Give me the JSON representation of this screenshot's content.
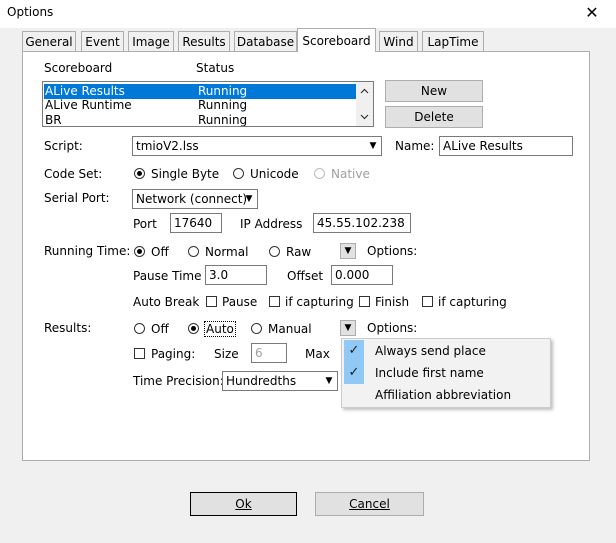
{
  "window": {
    "title": "Options",
    "close_glyph": "✕"
  },
  "tabs": [
    {
      "label": "General"
    },
    {
      "label": "Event"
    },
    {
      "label": "Image"
    },
    {
      "label": "Results"
    },
    {
      "label": "Database"
    },
    {
      "label": "Scoreboard"
    },
    {
      "label": "Wind"
    },
    {
      "label": "LapTime"
    }
  ],
  "active_tab": "Scoreboard",
  "scoreboard_list": {
    "col_scoreboard": "Scoreboard",
    "col_status": "Status",
    "rows": [
      {
        "name": "ALive Results",
        "status": "Running"
      },
      {
        "name": "ALive Runtime",
        "status": "Running"
      },
      {
        "name": "BR",
        "status": "Running"
      }
    ]
  },
  "buttons": {
    "new": "New",
    "delete": "Delete",
    "ok": "Ok",
    "cancel": "Cancel"
  },
  "script": {
    "label": "Script:",
    "value": "tmioV2.lss"
  },
  "name": {
    "label": "Name:",
    "value": "ALive Results"
  },
  "code_set": {
    "label": "Code Set:",
    "options": [
      "Single Byte",
      "Unicode",
      "Native"
    ],
    "selected": "Single Byte"
  },
  "serial_port": {
    "label": "Serial Port:",
    "value": "Network (connect)"
  },
  "port": {
    "label": "Port",
    "value": "17640"
  },
  "ip": {
    "label": "IP Address",
    "value": "45.55.102.238"
  },
  "running_time": {
    "label": "Running Time:",
    "options": [
      "Off",
      "Normal",
      "Raw"
    ],
    "selected": "Off",
    "options_label": "Options:"
  },
  "pause_time": {
    "label": "Pause Time",
    "value": "3.0"
  },
  "offset": {
    "label": "Offset",
    "value": "0.000"
  },
  "auto_break": {
    "label": "Auto Break",
    "items": [
      "Pause",
      "if capturing",
      "Finish",
      "if capturing"
    ]
  },
  "results": {
    "label": "Results:",
    "options": [
      "Off",
      "Auto",
      "Manual"
    ],
    "selected": "Auto",
    "options_label": "Options:"
  },
  "paging": {
    "label": "Paging:",
    "size_label": "Size",
    "size_value": "6",
    "max_label": "Max"
  },
  "time_precision": {
    "label": "Time Precision:",
    "value": "Hundredths"
  },
  "dropdown_menu": {
    "items": [
      {
        "label": "Always send place",
        "checked": true
      },
      {
        "label": "Include first name",
        "checked": true
      },
      {
        "label": "Affiliation abbreviation",
        "checked": false
      }
    ],
    "check_glyph": "✓"
  }
}
